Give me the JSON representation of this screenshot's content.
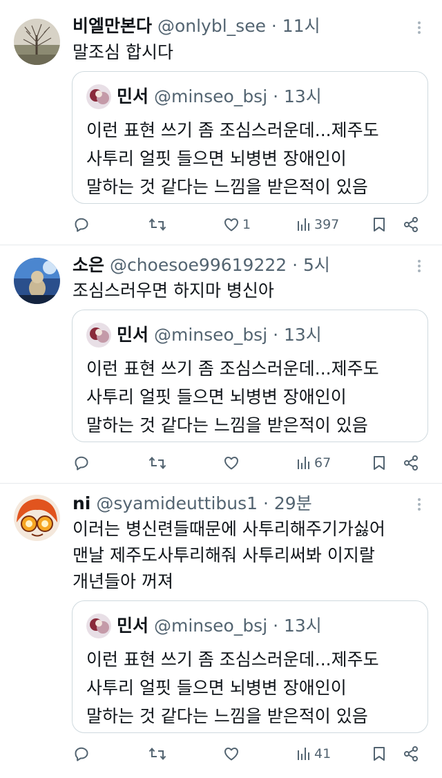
{
  "tweets": [
    {
      "name": "비엘만본다",
      "handle": "@onlybl_see",
      "sep": " · ",
      "time": "11시",
      "lines": [
        "말조심 합시다"
      ],
      "quote": {
        "name": "민서",
        "handle": "@minseo_bsj",
        "sep": " · ",
        "time": "13시",
        "lines": [
          "이런 표현 쓰기 좀 조심스러운데...제주도",
          "사투리 얼핏 들으면 뇌병변 장애인이",
          "말하는 것 같다는 느낌을 받은적이 있음"
        ]
      },
      "likes": "1",
      "views": "397"
    },
    {
      "name": "소은",
      "handle": "@choesoe99619222",
      "sep": " · ",
      "time": "5시",
      "lines": [
        "조심스러우면 하지마 병신아"
      ],
      "quote": {
        "name": "민서",
        "handle": "@minseo_bsj",
        "sep": " · ",
        "time": "13시",
        "lines": [
          "이런 표현 쓰기 좀 조심스러운데...제주도",
          "사투리 얼핏 들으면 뇌병변 장애인이",
          "말하는 것 같다는 느낌을 받은적이 있음"
        ]
      },
      "likes": "",
      "views": "67"
    },
    {
      "name": "ni",
      "handle": "@syamideuttibus1",
      "sep": " · ",
      "time": "29분",
      "lines": [
        "이러는 병신련들때문에 사투리해주기가싫어",
        "맨날 제주도사투리해줘 사투리써봐 이지랄",
        "개년들아 꺼져"
      ],
      "quote": {
        "name": "민서",
        "handle": "@minseo_bsj",
        "sep": " · ",
        "time": "13시",
        "lines": [
          "이런 표현 쓰기 좀 조심스러운데...제주도",
          "사투리 얼핏 들으면 뇌병변 장애인이",
          "말하는 것 같다는 느낌을 받은적이 있음"
        ]
      },
      "likes": "",
      "views": "41"
    }
  ],
  "icons": {
    "reply": "reply-icon",
    "retweet": "retweet-icon",
    "like": "heart-icon",
    "views": "views-icon",
    "bookmark": "bookmark-icon",
    "share": "share-icon",
    "more": "more-icon"
  },
  "colors": {
    "text": "#0f1419",
    "secondary": "#536471",
    "border": "#cfd9de"
  }
}
